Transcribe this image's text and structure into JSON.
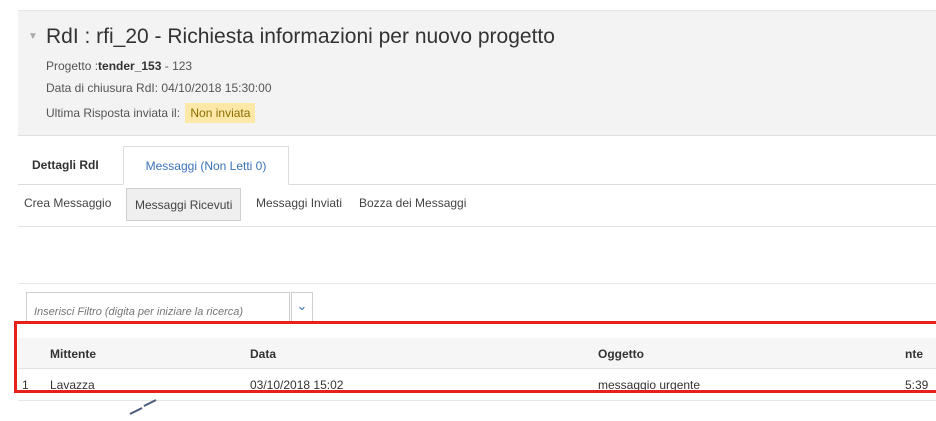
{
  "header": {
    "title": "RdI : rfi_20 - Richiesta informazioni per nuovo progetto",
    "project_label": "Progetto :",
    "project_code": "tender_153",
    "project_suffix": " - 123",
    "closing_date": "Data di chiusura RdI: 04/10/2018 15:30:00",
    "last_response_label": "Ultima Risposta inviata il:",
    "last_response_badge": "Non inviata"
  },
  "tabs": [
    {
      "label": "Dettagli RdI"
    },
    {
      "label": "Messaggi (Non Letti 0)"
    }
  ],
  "subtoolbar": [
    {
      "label": "Crea Messaggio"
    },
    {
      "label": "Messaggi Ricevuti"
    },
    {
      "label": "Messaggi Inviati"
    },
    {
      "label": "Bozza dei Messaggi"
    }
  ],
  "filter": {
    "placeholder": "Inserisci Filtro (digita per iniziare la ricerca)"
  },
  "table": {
    "columns": [
      "Mittente",
      "Data",
      "Oggetto",
      "nte"
    ],
    "rows": [
      {
        "index": "1",
        "sender": "Lavazza",
        "date": "03/10/2018 15:02",
        "subject": "messaggio urgente",
        "extra": "5:39"
      }
    ]
  },
  "colors": {
    "accent": "#3a72b8",
    "highlight": "#e6201b",
    "badge_bg": "#fde8a8"
  }
}
